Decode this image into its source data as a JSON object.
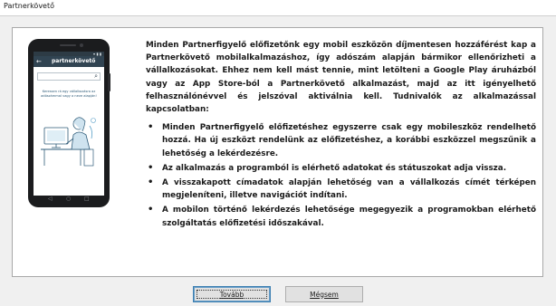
{
  "window": {
    "title": "Partnerkövető"
  },
  "phone": {
    "status_icons": "▾ ▮ ▮",
    "app_logo": "partnerkövető",
    "back_icon": "←",
    "hint_text": "Keressen rá egy vállalkozásra az adószámmal vagy a neve alapján!",
    "nav_icons": [
      "◁",
      "○",
      "□"
    ]
  },
  "content": {
    "intro": "Minden Partnerfigyelő előfizetőnk egy mobil eszközön díjmentesen hozzáférést kap a Partnerkövető mobilalkalmazáshoz, így adószám alapján bármikor ellenőrizheti a vállalkozásokat. Ehhez nem kell mást tennie, mint letölteni a Google Play áruházból vagy az App Store-ból a Partnerkövető alkalmazást, majd az itt igényelhető felhasználónévvel és jelszóval aktiválnia kell. Tudnivalók az alkalmazással kapcsolatban:",
    "bullets": [
      "Minden Partnerfigyelő előfizetéshez egyszerre csak egy mobileszköz rendelhető hozzá. Ha új eszközt rendelünk az előfizetéshez, a korábbi eszközzel megszűnik a lehetőség a lekérdezésre.",
      "Az alkalmazás a programból is elérhető adatokat és státuszokat adja vissza.",
      "A visszakapott címadatok alapján lehetőség van a vállalkozás címét térképen megjeleníteni, illetve navigációt indítani.",
      "A mobilon történő lekérdezés lehetősége megegyezik a programokban elérhető szolgáltatás előfizetési időszakával."
    ]
  },
  "buttons": {
    "next": "Tovább",
    "cancel": "Mégsem"
  }
}
